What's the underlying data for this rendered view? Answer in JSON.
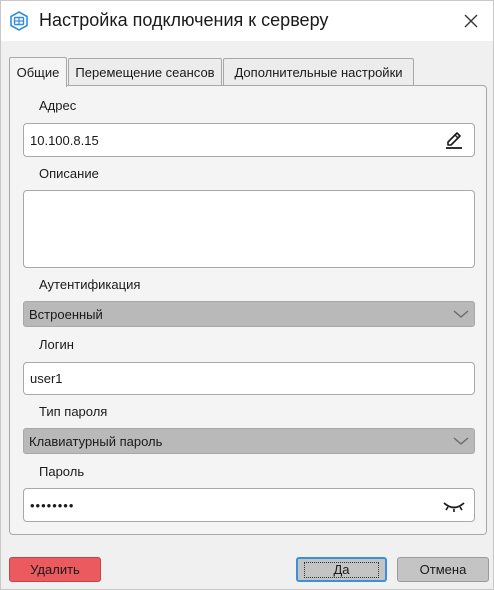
{
  "window": {
    "title": "Настройка подключения к серверу"
  },
  "tabs": [
    {
      "label": "Общие",
      "active": true
    },
    {
      "label": "Перемещение сеансов",
      "active": false
    },
    {
      "label": "Дополнительные настройки",
      "active": false
    }
  ],
  "form": {
    "address": {
      "label": "Адрес",
      "value": "10.100.8.15",
      "icon": "pencil-icon"
    },
    "description": {
      "label": "Описание",
      "value": ""
    },
    "auth": {
      "label": "Аутентификация",
      "value": "Встроенный"
    },
    "login": {
      "label": "Логин",
      "value": "user1"
    },
    "password_type": {
      "label": "Тип пароля",
      "value": "Клавиатурный пароль"
    },
    "password": {
      "label": "Пароль",
      "value": "••••••••",
      "icon": "eye-closed-icon"
    }
  },
  "buttons": {
    "delete": "Удалить",
    "ok": "Да",
    "cancel": "Отмена"
  },
  "colors": {
    "delete_button": "#eb5a5e",
    "focus_border": "#3d8fd9",
    "select_bg": "#b9b9b9",
    "app_icon": "#2f8ee0"
  }
}
